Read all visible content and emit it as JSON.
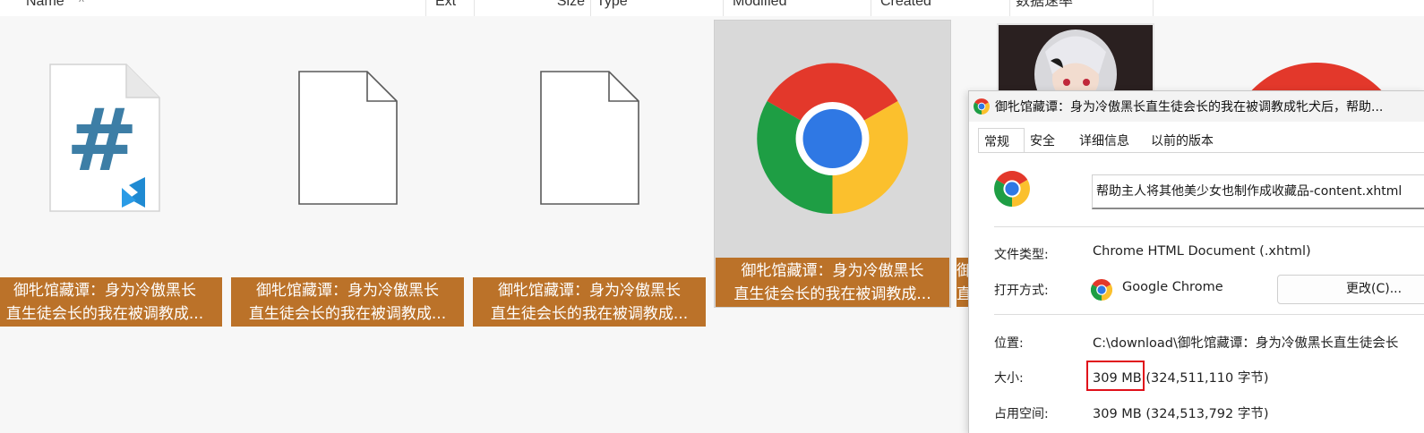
{
  "columns": [
    "Name",
    "Ext",
    "Size",
    "Type",
    "Modified",
    "Created",
    "数据速率"
  ],
  "sort_indicator": "^",
  "files": [
    {
      "icon": "csharp-file-icon",
      "label_line1": "御牝馆藏谭：身为冷傲黑长",
      "label_line2": "直生徒会长的我在被调教成..."
    },
    {
      "icon": "blank-file-icon",
      "label_line1": "御牝馆藏谭：身为冷傲黑长",
      "label_line2": "直生徒会长的我在被调教成..."
    },
    {
      "icon": "blank-file-icon",
      "label_line1": "御牝馆藏谭：身为冷傲黑长",
      "label_line2": "直生徒会长的我在被调教成..."
    },
    {
      "icon": "chrome-icon",
      "label_line1": "御牝馆藏谭：身为冷傲黑长",
      "label_line2": "直生徒会长的我在被调教成...",
      "selected": true
    },
    {
      "icon": "image-thumbnail",
      "label_line1": "御牝馆藏谭：身为冷傲黑长",
      "label_line2": "直生徒会长的我在被调教成..."
    }
  ],
  "dialog": {
    "title": "御牝馆藏谭：身为冷傲黑长直生徒会长的我在被调教成牝犬后，帮助...",
    "tabs": [
      "常规",
      "安全",
      "详细信息",
      "以前的版本"
    ],
    "filename": "帮助主人将其他美少女也制作成收藏品-content.xhtml",
    "type_label": "文件类型:",
    "type_value": "Chrome HTML Document (.xhtml)",
    "open_label": "打开方式:",
    "open_value": "Google Chrome",
    "change_button": "更改(C)...",
    "location_label": "位置:",
    "location_value": "C:\\download\\御牝馆藏谭：身为冷傲黑长直生徒会长",
    "size_label": "大小:",
    "size_value_main": "309 MB",
    "size_value_bytes": "(324,511,110 字节)",
    "disk_label": "占用空间:",
    "disk_value": "309 MB (324,513,792 字节)"
  },
  "colors": {
    "label_bg": "#bb7229",
    "selected_bg": "#d9d9d9",
    "highlight_box": "#e0101a"
  }
}
